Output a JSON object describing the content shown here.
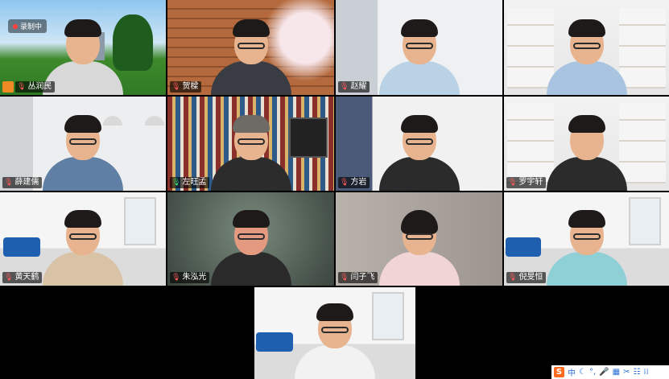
{
  "meeting": {
    "recording_label": "录制中",
    "participants": [
      {
        "name": "丛润民",
        "mic": "muted",
        "host": true
      },
      {
        "name": "贺樑",
        "mic": "muted"
      },
      {
        "name": "赵耀",
        "mic": "muted"
      },
      {
        "name": "",
        "mic": "none",
        "active_speaker": true
      },
      {
        "name": "薛建儒",
        "mic": "muted"
      },
      {
        "name": "左旺孟",
        "mic": "unmuted"
      },
      {
        "name": "方岩",
        "mic": "muted"
      },
      {
        "name": "罗宇轩",
        "mic": "muted"
      },
      {
        "name": "黄天鹤",
        "mic": "muted"
      },
      {
        "name": "朱泓光",
        "mic": "muted"
      },
      {
        "name": "闫子飞",
        "mic": "muted"
      },
      {
        "name": "倪旻恒",
        "mic": "muted"
      },
      {
        "name": "",
        "mic": "none"
      }
    ]
  },
  "ime_toolbar": {
    "logo": "S",
    "items": [
      "中",
      "☾",
      "°,",
      "🎤",
      "▦",
      "✂",
      "☷",
      "⁞⁞"
    ]
  },
  "colors": {
    "active_speaker_border": "#2fd35a",
    "mic_on": "#3fd46b",
    "host_badge": "#f08a24",
    "ime_logo": "#ff6a1f"
  }
}
